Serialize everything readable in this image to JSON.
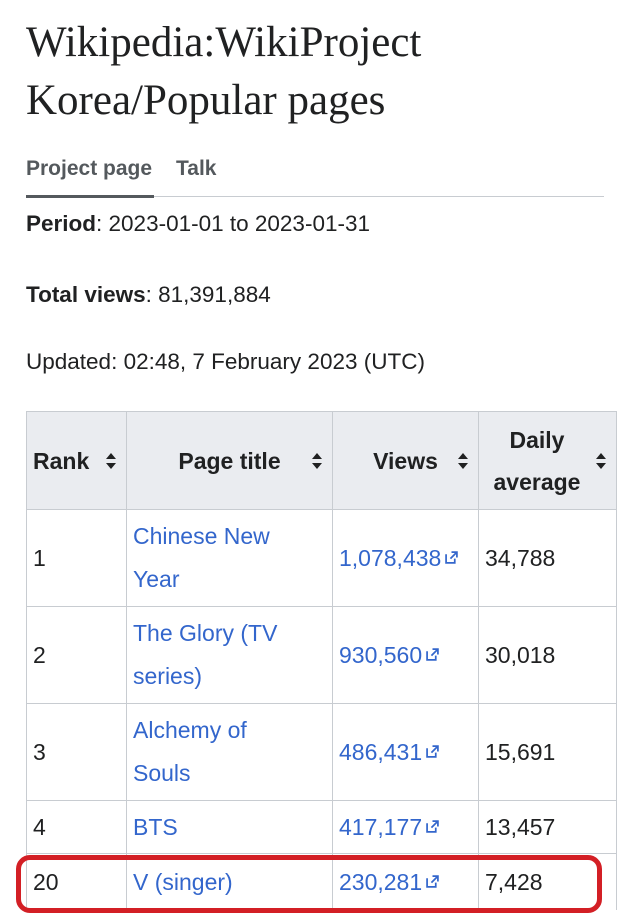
{
  "page": {
    "title_line1": "Wikipedia:WikiProject",
    "title_line2": "Korea/Popular pages"
  },
  "tabs": {
    "project_page": "Project page",
    "talk": "Talk"
  },
  "info": {
    "period_label": "Period",
    "period_value": ": 2023-01-01 to 2023-01-31",
    "total_label": "Total views",
    "total_value": ": 81,391,884",
    "updated": "Updated: 02:48, 7 February 2023 (UTC)"
  },
  "table": {
    "headers": {
      "rank": "Rank",
      "page_title": "Page title",
      "views": "Views",
      "daily_line1": "Daily",
      "daily_line2": "average"
    },
    "rows": [
      {
        "rank": "1",
        "title_line1": "Chinese New",
        "title_line2": "Year",
        "views": "1,078,438",
        "daily": "34,788"
      },
      {
        "rank": "2",
        "title_line1": "The Glory (TV",
        "title_line2": "series)",
        "views": "930,560",
        "daily": "30,018"
      },
      {
        "rank": "3",
        "title_line1": "Alchemy of",
        "title_line2": "Souls",
        "views": "486,431",
        "daily": "15,691"
      },
      {
        "rank": "4",
        "title": "BTS",
        "views": "417,177",
        "daily": "13,457"
      },
      {
        "rank": "20",
        "title": "V (singer)",
        "views": "230,281",
        "daily": "7,428"
      }
    ]
  },
  "colors": {
    "link": "#3366cc",
    "header_bg": "#eaecf0",
    "border": "#c8ccd1",
    "highlight": "#d31f25"
  },
  "icons": [
    "sort-icon",
    "external-link-icon"
  ]
}
